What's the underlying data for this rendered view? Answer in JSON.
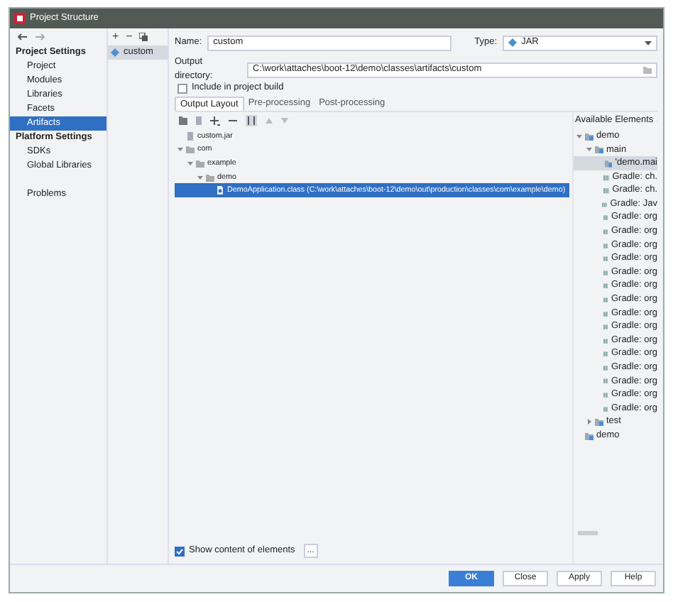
{
  "window": {
    "title": "Project Structure"
  },
  "sidebar": {
    "sections": [
      {
        "title": "Project Settings",
        "items": [
          {
            "label": "Project",
            "selected": false
          },
          {
            "label": "Modules",
            "selected": false
          },
          {
            "label": "Libraries",
            "selected": false
          },
          {
            "label": "Facets",
            "selected": false
          },
          {
            "label": "Artifacts",
            "selected": true
          }
        ]
      },
      {
        "title": "Platform Settings",
        "items": [
          {
            "label": "SDKs",
            "selected": false
          },
          {
            "label": "Global Libraries",
            "selected": false
          }
        ]
      },
      {
        "items": [
          {
            "label": "Problems",
            "selected": false
          }
        ]
      }
    ]
  },
  "artifacts": {
    "toolbar": [
      "+",
      "−"
    ],
    "items": [
      {
        "label": "custom",
        "selected": true
      }
    ]
  },
  "form": {
    "name_label": "Name:",
    "name_value": "custom",
    "type_label": "Type:",
    "type_value": "JAR",
    "output_label": "Output directory:",
    "output_value": "C:\\work\\attaches\\boot-12\\demo\\classes\\artifacts\\custom",
    "include_label": "Include in project build",
    "include_checked": false
  },
  "tabs": [
    {
      "label": "Output Layout",
      "selected": true
    },
    {
      "label": "Pre-processing",
      "selected": false
    },
    {
      "label": "Post-processing",
      "selected": false
    }
  ],
  "layout_tree": [
    {
      "kind": "jar",
      "label": "custom.jar",
      "selected": false
    },
    {
      "kind": "folder",
      "label": "com",
      "selected": false,
      "expanded": true,
      "children": [
        {
          "kind": "folder",
          "label": "example",
          "selected": false,
          "expanded": true,
          "children": [
            {
              "kind": "folder",
              "label": "demo",
              "selected": false,
              "expanded": true,
              "children": [
                {
                  "kind": "class",
                  "label": "DemoApplication.class (C:\\work\\attaches\\boot-12\\demo\\out\\production\\classes\\com\\example\\demo)",
                  "selected": true
                }
              ]
            }
          ]
        }
      ]
    }
  ],
  "available": {
    "title": "Available Elements",
    "tree": [
      {
        "kind": "module",
        "label": "demo",
        "selected": false,
        "expanded": true,
        "children": [
          {
            "kind": "module",
            "label": "main",
            "selected": false,
            "expanded": true,
            "children": [
              {
                "kind": "output",
                "label": "'demo.mai",
                "selected": true
              },
              {
                "kind": "library",
                "label": "Gradle: ch.",
                "selected": false
              },
              {
                "kind": "library",
                "label": "Gradle: ch.",
                "selected": false
              },
              {
                "kind": "library",
                "label": "Gradle: Jav",
                "selected": false
              },
              {
                "kind": "library",
                "label": "Gradle: org",
                "selected": false
              },
              {
                "kind": "library",
                "label": "Gradle: org",
                "selected": false
              },
              {
                "kind": "library",
                "label": "Gradle: org",
                "selected": false
              },
              {
                "kind": "library",
                "label": "Gradle: org",
                "selected": false
              },
              {
                "kind": "library",
                "label": "Gradle: org",
                "selected": false
              },
              {
                "kind": "library",
                "label": "Gradle: org",
                "selected": false
              },
              {
                "kind": "library",
                "label": "Gradle: org",
                "selected": false
              },
              {
                "kind": "library",
                "label": "Gradle: org",
                "selected": false
              },
              {
                "kind": "library",
                "label": "Gradle: org",
                "selected": false
              },
              {
                "kind": "library",
                "label": "Gradle: org",
                "selected": false
              },
              {
                "kind": "library",
                "label": "Gradle: org",
                "selected": false
              },
              {
                "kind": "library",
                "label": "Gradle: org",
                "selected": false
              },
              {
                "kind": "library",
                "label": "Gradle: org",
                "selected": false
              },
              {
                "kind": "library",
                "label": "Gradle: org",
                "selected": false
              },
              {
                "kind": "library",
                "label": "Gradle: org",
                "selected": false
              }
            ]
          },
          {
            "kind": "module",
            "label": "test",
            "selected": false,
            "expanded": false
          }
        ]
      },
      {
        "kind": "module",
        "label": "demo",
        "selected": false
      }
    ]
  },
  "show_content": {
    "label": "Show content of elements",
    "checked": true,
    "button": "..."
  },
  "buttons": [
    {
      "label": "OK",
      "primary": true
    },
    {
      "label": "Close",
      "primary": false
    },
    {
      "label": "Apply",
      "primary": false
    },
    {
      "label": "Help",
      "primary": false
    }
  ]
}
